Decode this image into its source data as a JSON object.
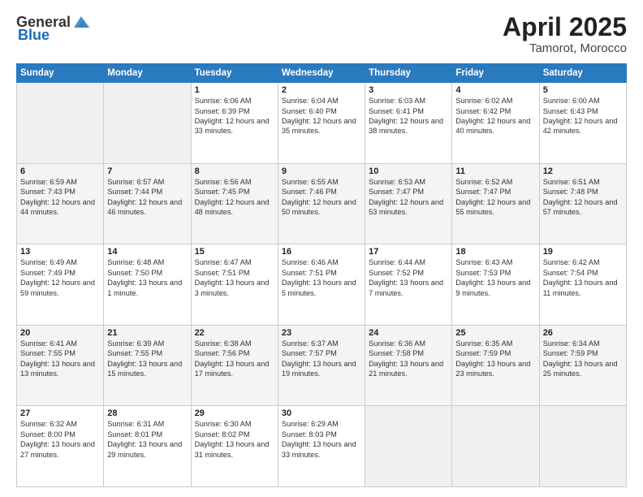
{
  "header": {
    "logo_general": "General",
    "logo_blue": "Blue",
    "month": "April 2025",
    "location": "Tamorot, Morocco"
  },
  "weekdays": [
    "Sunday",
    "Monday",
    "Tuesday",
    "Wednesday",
    "Thursday",
    "Friday",
    "Saturday"
  ],
  "weeks": [
    [
      {
        "day": "",
        "info": ""
      },
      {
        "day": "",
        "info": ""
      },
      {
        "day": "1",
        "info": "Sunrise: 6:06 AM\nSunset: 6:39 PM\nDaylight: 12 hours and 33 minutes."
      },
      {
        "day": "2",
        "info": "Sunrise: 6:04 AM\nSunset: 6:40 PM\nDaylight: 12 hours and 35 minutes."
      },
      {
        "day": "3",
        "info": "Sunrise: 6:03 AM\nSunset: 6:41 PM\nDaylight: 12 hours and 38 minutes."
      },
      {
        "day": "4",
        "info": "Sunrise: 6:02 AM\nSunset: 6:42 PM\nDaylight: 12 hours and 40 minutes."
      },
      {
        "day": "5",
        "info": "Sunrise: 6:00 AM\nSunset: 6:43 PM\nDaylight: 12 hours and 42 minutes."
      }
    ],
    [
      {
        "day": "6",
        "info": "Sunrise: 6:59 AM\nSunset: 7:43 PM\nDaylight: 12 hours and 44 minutes."
      },
      {
        "day": "7",
        "info": "Sunrise: 6:57 AM\nSunset: 7:44 PM\nDaylight: 12 hours and 46 minutes."
      },
      {
        "day": "8",
        "info": "Sunrise: 6:56 AM\nSunset: 7:45 PM\nDaylight: 12 hours and 48 minutes."
      },
      {
        "day": "9",
        "info": "Sunrise: 6:55 AM\nSunset: 7:46 PM\nDaylight: 12 hours and 50 minutes."
      },
      {
        "day": "10",
        "info": "Sunrise: 6:53 AM\nSunset: 7:47 PM\nDaylight: 12 hours and 53 minutes."
      },
      {
        "day": "11",
        "info": "Sunrise: 6:52 AM\nSunset: 7:47 PM\nDaylight: 12 hours and 55 minutes."
      },
      {
        "day": "12",
        "info": "Sunrise: 6:51 AM\nSunset: 7:48 PM\nDaylight: 12 hours and 57 minutes."
      }
    ],
    [
      {
        "day": "13",
        "info": "Sunrise: 6:49 AM\nSunset: 7:49 PM\nDaylight: 12 hours and 59 minutes."
      },
      {
        "day": "14",
        "info": "Sunrise: 6:48 AM\nSunset: 7:50 PM\nDaylight: 13 hours and 1 minute."
      },
      {
        "day": "15",
        "info": "Sunrise: 6:47 AM\nSunset: 7:51 PM\nDaylight: 13 hours and 3 minutes."
      },
      {
        "day": "16",
        "info": "Sunrise: 6:46 AM\nSunset: 7:51 PM\nDaylight: 13 hours and 5 minutes."
      },
      {
        "day": "17",
        "info": "Sunrise: 6:44 AM\nSunset: 7:52 PM\nDaylight: 13 hours and 7 minutes."
      },
      {
        "day": "18",
        "info": "Sunrise: 6:43 AM\nSunset: 7:53 PM\nDaylight: 13 hours and 9 minutes."
      },
      {
        "day": "19",
        "info": "Sunrise: 6:42 AM\nSunset: 7:54 PM\nDaylight: 13 hours and 11 minutes."
      }
    ],
    [
      {
        "day": "20",
        "info": "Sunrise: 6:41 AM\nSunset: 7:55 PM\nDaylight: 13 hours and 13 minutes."
      },
      {
        "day": "21",
        "info": "Sunrise: 6:39 AM\nSunset: 7:55 PM\nDaylight: 13 hours and 15 minutes."
      },
      {
        "day": "22",
        "info": "Sunrise: 6:38 AM\nSunset: 7:56 PM\nDaylight: 13 hours and 17 minutes."
      },
      {
        "day": "23",
        "info": "Sunrise: 6:37 AM\nSunset: 7:57 PM\nDaylight: 13 hours and 19 minutes."
      },
      {
        "day": "24",
        "info": "Sunrise: 6:36 AM\nSunset: 7:58 PM\nDaylight: 13 hours and 21 minutes."
      },
      {
        "day": "25",
        "info": "Sunrise: 6:35 AM\nSunset: 7:59 PM\nDaylight: 13 hours and 23 minutes."
      },
      {
        "day": "26",
        "info": "Sunrise: 6:34 AM\nSunset: 7:59 PM\nDaylight: 13 hours and 25 minutes."
      }
    ],
    [
      {
        "day": "27",
        "info": "Sunrise: 6:32 AM\nSunset: 8:00 PM\nDaylight: 13 hours and 27 minutes."
      },
      {
        "day": "28",
        "info": "Sunrise: 6:31 AM\nSunset: 8:01 PM\nDaylight: 13 hours and 29 minutes."
      },
      {
        "day": "29",
        "info": "Sunrise: 6:30 AM\nSunset: 8:02 PM\nDaylight: 13 hours and 31 minutes."
      },
      {
        "day": "30",
        "info": "Sunrise: 6:29 AM\nSunset: 8:03 PM\nDaylight: 13 hours and 33 minutes."
      },
      {
        "day": "",
        "info": ""
      },
      {
        "day": "",
        "info": ""
      },
      {
        "day": "",
        "info": ""
      }
    ]
  ]
}
